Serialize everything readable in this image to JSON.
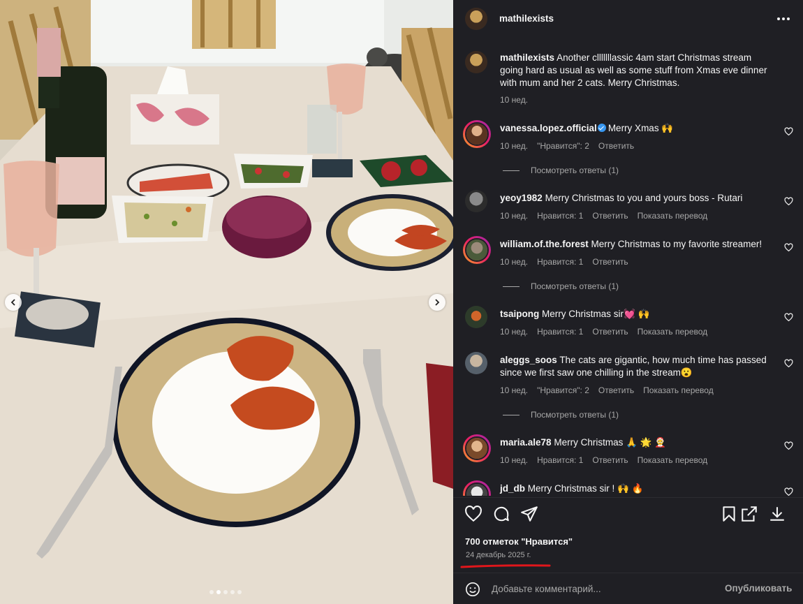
{
  "post": {
    "author": "mathilexists",
    "caption_author": "mathilexists",
    "caption": "Another clllllllassic 4am start Christmas stream going hard as usual as well as some stuff from Xmas eve dinner with mum and her 2 cats. Merry Christmas.",
    "caption_time": "10 нед.",
    "likes": "700 отметок \"Нравится\"",
    "date": "24 декабрь 2025 г.",
    "image_count": 5,
    "current_image": 2
  },
  "comments": [
    {
      "user": "vanessa.lopez.official",
      "verified": true,
      "text": "Merry Xmas 🙌",
      "time": "10 нед.",
      "likes": "\"Нравится\": 2",
      "reply": "Ответить",
      "translate": "",
      "view_replies": "Посмотреть ответы (1)"
    },
    {
      "user": "yeoy1982",
      "verified": false,
      "text": "Merry Christmas to you and yours boss - Rutari",
      "time": "10 нед.",
      "likes": "Нравится: 1",
      "reply": "Ответить",
      "translate": "Показать перевод",
      "view_replies": ""
    },
    {
      "user": "william.of.the.forest",
      "verified": false,
      "text": "Merry Christmas to my favorite streamer!",
      "time": "10 нед.",
      "likes": "Нравится: 1",
      "reply": "Ответить",
      "translate": "",
      "view_replies": "Посмотреть ответы (1)"
    },
    {
      "user": "tsaipong",
      "verified": false,
      "text": "Merry Christmas sir💓 🙌",
      "time": "10 нед.",
      "likes": "Нравится: 1",
      "reply": "Ответить",
      "translate": "Показать перевод",
      "view_replies": ""
    },
    {
      "user": "aleggs_soos",
      "verified": false,
      "text": "The cats are gigantic, how much time has passed since we first saw one chilling in the stream😮",
      "time": "10 нед.",
      "likes": "\"Нравится\": 2",
      "reply": "Ответить",
      "translate": "Показать перевод",
      "view_replies": "Посмотреть ответы (1)"
    },
    {
      "user": "maria.ale78",
      "verified": false,
      "text": "Merry Christmas 🙏 🌟 🤶",
      "time": "10 нед.",
      "likes": "Нравится: 1",
      "reply": "Ответить",
      "translate": "Показать перевод",
      "view_replies": ""
    },
    {
      "user": "jd_db",
      "verified": false,
      "text": "Merry Christmas sir ! 🙌 🔥",
      "time": "",
      "likes": "",
      "reply": "",
      "translate": "",
      "view_replies": ""
    }
  ],
  "composer": {
    "placeholder": "Добавьте комментарий...",
    "publish": "Опубликовать"
  },
  "colors": {
    "panel_bg": "#1f1f24",
    "text_primary": "#f5f5f5",
    "text_secondary": "#a8a8a8",
    "verified": "#3897f0",
    "annotation_underline": "#e0161b"
  },
  "icons": [
    "heart-icon",
    "comment-icon",
    "share-icon",
    "bookmark-icon",
    "external-link-icon",
    "download-icon",
    "emoji-icon",
    "more-icon",
    "chevron-left-icon",
    "chevron-right-icon"
  ]
}
